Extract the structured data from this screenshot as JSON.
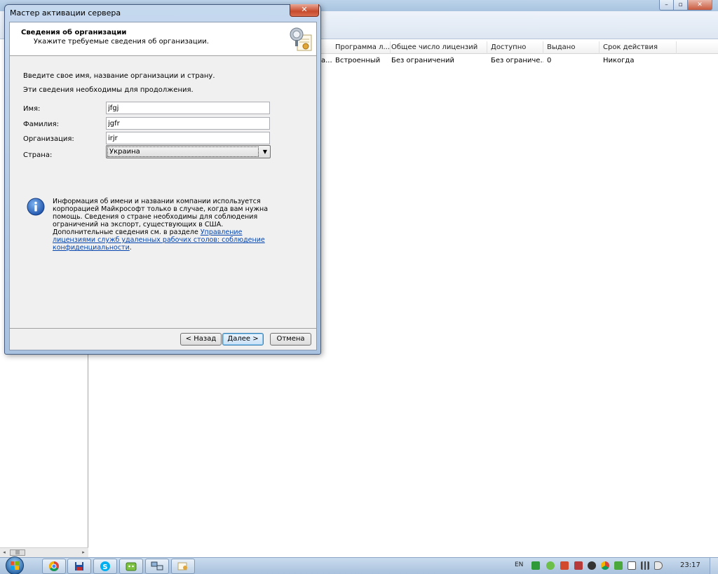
{
  "background_window": {
    "table": {
      "columns": [
        "Программа л...",
        "Общее число лицензий",
        "Доступно",
        "Выдано",
        "Срок действия"
      ],
      "rows": [
        [
          "а...",
          "Встроенный",
          "Без ограничений",
          "Без ограниче...",
          "0",
          "Никогда"
        ]
      ]
    },
    "controls": {
      "minimize": "–",
      "maximize": "▫",
      "close": "✕"
    }
  },
  "dialog": {
    "title": "Мастер активации сервера",
    "close_glyph": "✕",
    "heading": "Сведения об организации",
    "subheading": "Укажите требуемые сведения об организации.",
    "intro_line1": "Введите свое имя, название организации и страну.",
    "intro_line2": "Эти сведения необходимы для продолжения.",
    "fields": {
      "first_name": {
        "label": "Имя:",
        "value": "jfgj"
      },
      "last_name": {
        "label": "Фамилия:",
        "value": "jgfr"
      },
      "organization": {
        "label": "Организация:",
        "value": "irjr"
      },
      "country": {
        "label": "Страна:",
        "value": "Украина"
      }
    },
    "info": {
      "text": "Информация об имени и названии компании используется корпорацией Майкрософт только в случае, когда вам нужна помощь. Сведения о стране необходимы для соблюдения ограничений на экспорт, существующих в США. Дополнительные сведения см. в разделе ",
      "link": "Управление лицензиями служб удаленных рабочих столов: соблюдение конфиденциальности",
      "tail": "."
    },
    "buttons": {
      "back": "< Назад",
      "next": "Далее >",
      "cancel": "Отмена"
    }
  },
  "taskbar": {
    "language": "EN",
    "clock": "23:17"
  },
  "colors": {
    "accent_blue": "#3c7fb1",
    "close_red": "#c74a2c",
    "link": "#0645ad"
  }
}
